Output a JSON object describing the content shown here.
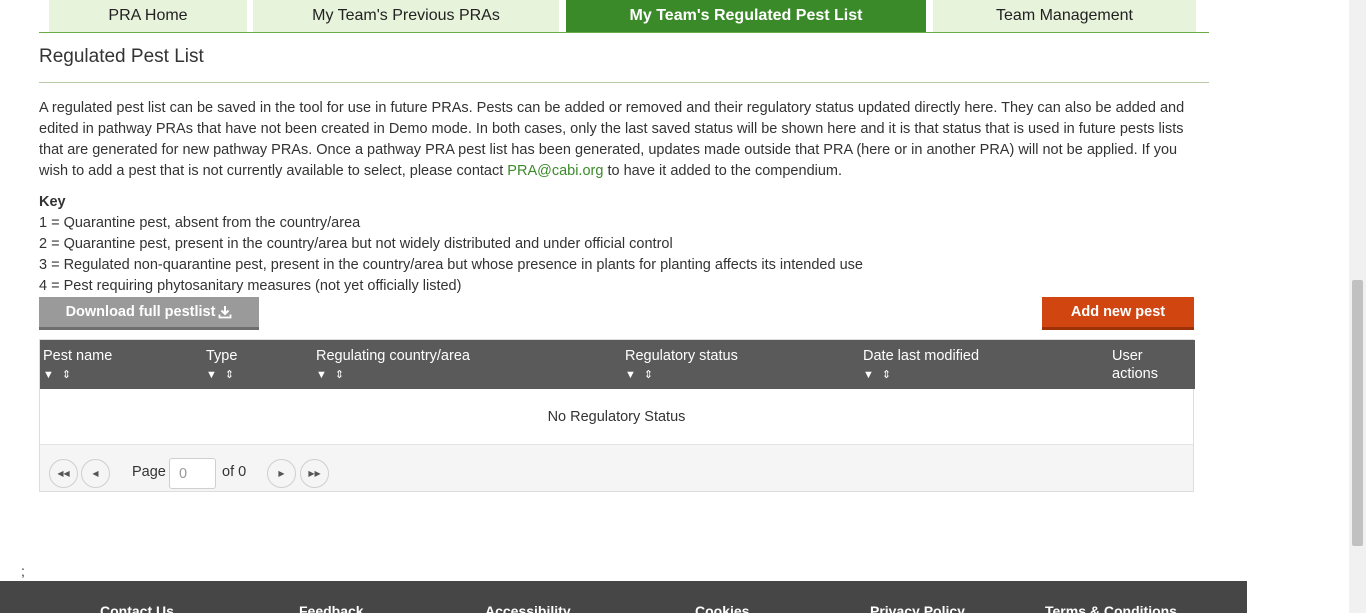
{
  "tabs": [
    {
      "label": "PRA Home"
    },
    {
      "label": "My Team's Previous PRAs"
    },
    {
      "label": "My Team's Regulated Pest List"
    },
    {
      "label": "Team Management"
    }
  ],
  "page_title": "Regulated Pest List",
  "intro": {
    "text_before_link": "A regulated pest list can be saved in the tool for use in future PRAs. Pests can be added or removed and their regulatory status updated directly here. They can also be added and edited in pathway PRAs that have not been created in Demo mode. In both cases, only the last saved status will be shown here and it is that status that is used in future pests lists that are generated for new pathway PRAs. Once a pathway PRA pest list has been generated, updates made outside that PRA (here or in another PRA) will not be applied. If you wish to add a pest that is not currently available to select, please contact ",
    "link_text": "PRA@cabi.org",
    "text_after_link": " to have it added to the compendium."
  },
  "key": {
    "title": "Key",
    "items": [
      "1 = Quarantine pest, absent from the country/area",
      "2 = Quarantine pest, present in the country/area but not widely distributed and under official control",
      "3 = Regulated non-quarantine pest, present in the country/area but whose presence in plants for planting affects its intended use",
      "4 = Pest requiring phytosanitary measures (not yet officially listed)"
    ]
  },
  "buttons": {
    "download": "Download full pestlist",
    "add": "Add new pest"
  },
  "table": {
    "columns": [
      "Pest name",
      "Type",
      "Regulating country/area",
      "Regulatory status",
      "Date last modified",
      "User actions"
    ],
    "empty_message": "No Regulatory Status"
  },
  "pager": {
    "page_label": "Page",
    "page_value": "0",
    "of_label": "of 0"
  },
  "stray_text": ";",
  "footer": {
    "links": [
      "Contact Us",
      "Feedback",
      "Accessibility",
      "Cookies",
      "Privacy Policy",
      "Terms & Conditions"
    ]
  },
  "colors": {
    "accent_green": "#3b8a2a",
    "tab_bg": "#e8f3dc",
    "add_button": "#d04510",
    "download_button": "#9a9a9a",
    "table_header": "#5a5a5a",
    "footer_bg": "#464646"
  }
}
